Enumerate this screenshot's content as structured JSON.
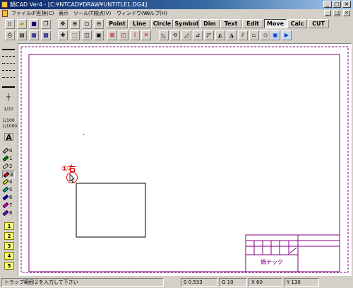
{
  "window": {
    "title": "鍋CAD Ver4 - [C:¥NTCAD¥DRAW¥UNTITLE1.DG4]",
    "controls": [
      "_",
      "□",
      "×"
    ]
  },
  "menu": {
    "items": [
      "ファイル(F)",
      "互換(C)",
      "表示",
      "ツール(T)",
      "視点(V)",
      "ウィンドウ(W)",
      "ヘルプ(H)"
    ],
    "mdi_controls": [
      "_",
      "□",
      "×"
    ]
  },
  "toolbar": {
    "tabs": [
      "Point",
      "Line",
      "Circle",
      "Symbol",
      "Dim",
      "Text",
      "Edit",
      "Move",
      "Calc",
      "CUT"
    ],
    "active_tab": "Move"
  },
  "left_toolbar": {
    "pens": [
      "0",
      "1",
      "2",
      "3",
      "4",
      "5",
      "6",
      "7",
      "8"
    ],
    "selected_pen": "3",
    "pen_colors": [
      "#c0c0c0",
      "#00a000",
      "#ffffff",
      "#ff0000",
      "#ffff00",
      "#00c0c0",
      "#0000ff",
      "#ff00ff",
      "#8000ff"
    ],
    "layers": [
      "1",
      "2",
      "3",
      "4",
      "5"
    ],
    "text_tool": "A"
  },
  "canvas": {
    "annotation": "①右",
    "title_block_text": "鍋テック",
    "frame_color": "#800080",
    "annotation_color": "#e00000"
  },
  "status": {
    "message": "トラップ範囲２を入力して下さい",
    "s": "S 0.533",
    "g": "G 10",
    "x": "X 60",
    "y": "Y 130"
  }
}
